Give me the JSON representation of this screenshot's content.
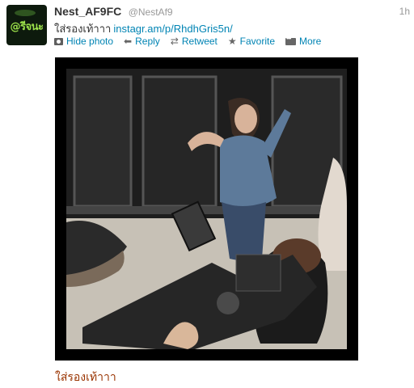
{
  "tweet": {
    "avatar_text": "@รีจนะ",
    "display_name": "Nest_AF9FC",
    "screen_name": "@NestAf9",
    "time": "1h",
    "text": "ใส่รองเท้าาา",
    "link": "instagr.am/p/RhdhGris5n/",
    "actions": {
      "hide_photo": "Hide photo",
      "reply": "Reply",
      "retweet": "Retweet",
      "favorite": "Favorite",
      "more": "More"
    },
    "photo_caption": "ใส่รองเท้าาา"
  },
  "colors": {
    "link": "#0084b4",
    "caption": "#993300",
    "secondary_text": "#999999"
  }
}
